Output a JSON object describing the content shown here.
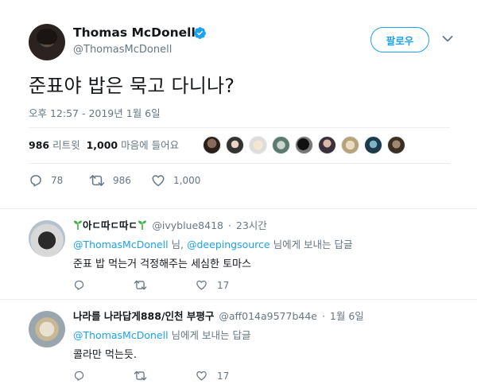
{
  "tweet": {
    "author_name": "Thomas McDonell",
    "author_handle": "@ThomasMcDonell",
    "follow_label": "팔로우",
    "text": "준표야 밥은 묵고 다니나?",
    "timestamp": "오후 12:57 - 2019년 1월 6일",
    "retweets_count": "986",
    "retweets_label": "리트윗",
    "likes_count": "1,000",
    "likes_label": "마음에 들어요",
    "actions": {
      "reply_count": "78",
      "retweet_count": "986",
      "like_count": "1,000"
    }
  },
  "replies": [
    {
      "name_prefix": "아ㄷ따ㄷ따ㄷ",
      "handle": "@ivyblue8418",
      "time": "23시간",
      "mention_1": "@ThomasMcDonell",
      "context_mid": "님,",
      "mention_2": "@deepingsource",
      "context_suffix": "님에게 보내는 답글",
      "text": "준표 밥 먹는거 걱정해주는 세심한 토마스",
      "like_count": "17"
    },
    {
      "name": "나라를 나라답게888/인천 부평구",
      "handle": "@aff014a9577b44e",
      "time": "1월 6일",
      "mention_1": "@ThomasMcDonell",
      "context_suffix": "님에게 보내는 답글",
      "text": "콜라만 먹는듯.",
      "like_count": "17"
    }
  ],
  "colors": {
    "accent": "#1da1f2",
    "text": "#14171a",
    "muted": "#657786",
    "border": "#e6ecf0",
    "sprout": "#3cb043"
  },
  "icons": [
    "verified-icon",
    "caret-down-icon",
    "reply-icon",
    "retweet-icon",
    "heart-icon",
    "sprout-icon"
  ]
}
